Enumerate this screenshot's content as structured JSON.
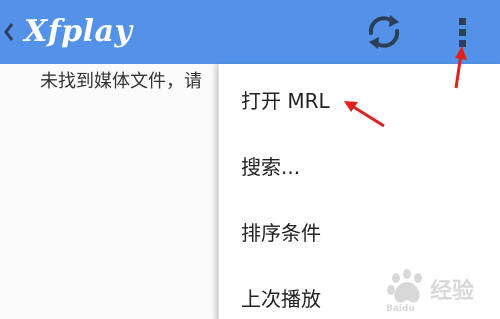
{
  "app": {
    "title": "Xfplay",
    "accent_color": "#5392e8"
  },
  "actionbar": {
    "back_icon": "chevron-left-icon",
    "refresh_icon": "refresh-icon",
    "overflow_icon": "more-vert-icon"
  },
  "content": {
    "empty_message": "未找到媒体文件，请"
  },
  "menu": {
    "items": [
      {
        "label": "打开 MRL"
      },
      {
        "label": "搜索..."
      },
      {
        "label": "排序条件"
      },
      {
        "label": "上次播放"
      }
    ]
  },
  "annotations": {
    "color": "#e0201c"
  },
  "watermark": {
    "text": "Baidu 经验"
  }
}
